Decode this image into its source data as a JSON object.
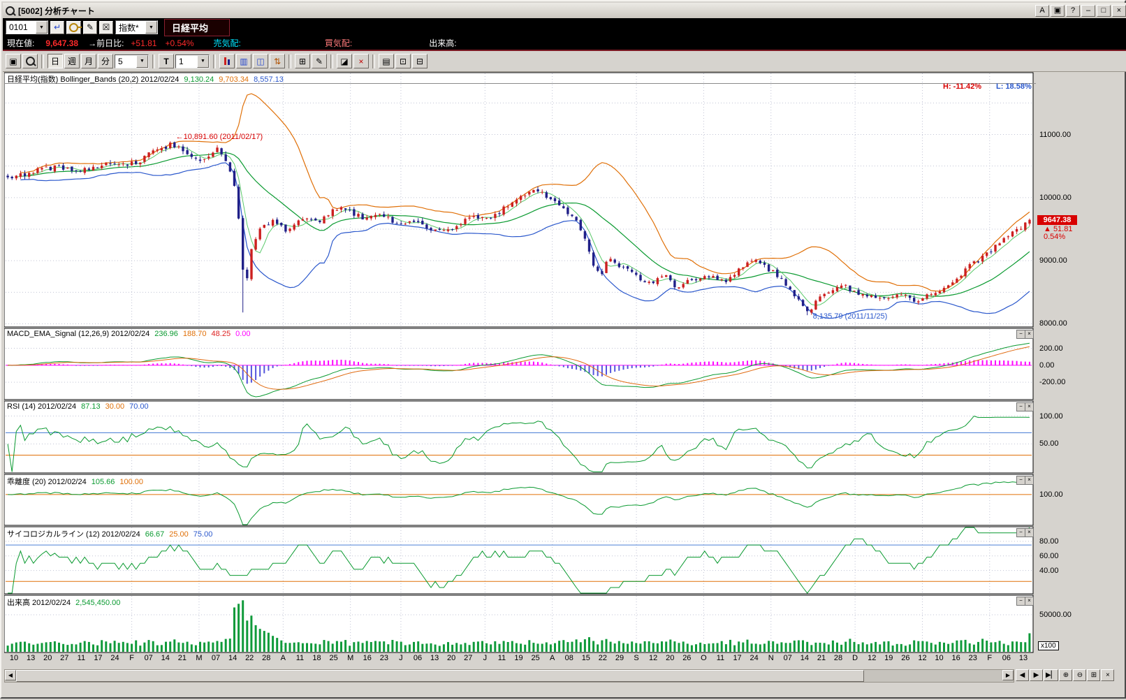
{
  "window": {
    "title": "[5002]  分析チャート",
    "buttons": [
      "A",
      "▣",
      "?",
      "–",
      "□",
      "×"
    ]
  },
  "icons": {
    "dropdown": "▼",
    "minimize": "−",
    "close": "×"
  },
  "toolbar1": {
    "code_value": "0101",
    "index_label": "指数*",
    "instrument": "日経平均",
    "icons": [
      {
        "name": "enter",
        "glyph": "↵",
        "color": "#2244cc"
      },
      {
        "name": "register-key",
        "kind": "key"
      },
      {
        "name": "memo-edit",
        "glyph": "✎"
      },
      {
        "name": "memo-delete",
        "glyph": "☒"
      }
    ]
  },
  "infobar": {
    "segments": [
      {
        "t": "現在値:",
        "c": "#ffffff"
      },
      {
        "t": "9,647.38",
        "c": "#ff2a2a",
        "ml": 16,
        "b": true
      },
      {
        "t": "→前日比:",
        "c": "#ffffff",
        "ml": 14
      },
      {
        "t": "+51.81",
        "c": "#ff2a2a",
        "ml": 10
      },
      {
        "t": "+0.54%",
        "c": "#ff2a2a",
        "ml": 12
      },
      {
        "t": "売気配:",
        "c": "#00e5ff",
        "ml": 28
      },
      {
        "t": "買気配:",
        "c": "#ff7a7a",
        "ml": 120
      },
      {
        "t": "出来高:",
        "c": "#ffffff",
        "ml": 110
      }
    ]
  },
  "toolbar2": {
    "periods": [
      "日",
      "週",
      "月",
      "分"
    ],
    "combo1": "5",
    "t_label": "T",
    "combo2": "1",
    "lead_icons": [
      {
        "name": "new-chart-window",
        "glyph": "▣"
      },
      {
        "name": "chart-search",
        "kind": "mag"
      }
    ],
    "trail_icons": [
      {
        "name": "candlestick-style",
        "kind": "candle"
      },
      {
        "name": "bar-style",
        "glyph": "▥",
        "color": "#2244cc"
      },
      {
        "name": "ohlc-style",
        "glyph": "◫",
        "color": "#2244cc"
      },
      {
        "name": "compare-style",
        "glyph": "⇅",
        "color": "#b05000"
      },
      {
        "sep": true
      },
      {
        "name": "grid-toggle",
        "glyph": "⊞"
      },
      {
        "name": "trendline-tool",
        "glyph": "✎"
      },
      {
        "sep": true
      },
      {
        "name": "eraser-tool",
        "glyph": "◪"
      },
      {
        "name": "delete-drawings",
        "glyph": "×",
        "color": "#c00000"
      },
      {
        "sep": true
      },
      {
        "name": "print-chart",
        "glyph": "▤"
      },
      {
        "name": "copy-chart",
        "glyph": "⊡"
      },
      {
        "name": "save-chart",
        "glyph": "⊟"
      }
    ]
  },
  "panels": {
    "price": {
      "title_segments": [
        {
          "t": "日経平均(指数) Bollinger_Bands (20,2) 2012/02/24",
          "c": "#000000"
        },
        {
          "t": "9,130.24",
          "c": "#0a9a30",
          "ml": 7
        },
        {
          "t": "9,703.34",
          "c": "#e07008",
          "ml": 7
        },
        {
          "t": "8,557.13",
          "c": "#2b58cc",
          "ml": 7
        }
      ],
      "hl_high": "H: -11.42%",
      "hl_low": "L: 18.58%",
      "annotation_high": "←10,891.60 (2011/02/17)",
      "annotation_low": "8,135.79 (2011/11/25)",
      "axis": [
        {
          "v": 11000,
          "label": "11000.00"
        },
        {
          "v": 10000,
          "label": "10000.00"
        },
        {
          "v": 9000,
          "label": "9000.00"
        },
        {
          "v": 8000,
          "label": "8000.00"
        }
      ],
      "tag": {
        "label": "9647.38",
        "change": "▲ 51.81",
        "pct": "0.54%"
      }
    },
    "macd": {
      "title_segments": [
        {
          "t": "MACD_EMA_Signal (12,26,9) 2012/02/24",
          "c": "#000000"
        },
        {
          "t": "236.96",
          "c": "#0a9a30",
          "ml": 7
        },
        {
          "t": "188.70",
          "c": "#e07008",
          "ml": 7
        },
        {
          "t": "48.25",
          "c": "#dd2222",
          "ml": 7
        },
        {
          "t": "0.00",
          "c": "#ff00ff",
          "ml": 7
        }
      ],
      "axis": [
        {
          "v": 200,
          "label": "200.00"
        },
        {
          "v": 0,
          "label": "0.00"
        },
        {
          "v": -200,
          "label": "-200.00"
        }
      ]
    },
    "rsi": {
      "title_segments": [
        {
          "t": "RSI (14) 2012/02/24",
          "c": "#000000"
        },
        {
          "t": "87.13",
          "c": "#0a9a30",
          "ml": 7
        },
        {
          "t": "30.00",
          "c": "#e07008",
          "ml": 7
        },
        {
          "t": "70.00",
          "c": "#2b58cc",
          "ml": 7
        }
      ],
      "axis": [
        {
          "v": 100,
          "label": "100.00"
        },
        {
          "v": 50,
          "label": "50.00"
        }
      ]
    },
    "kairi": {
      "title_segments": [
        {
          "t": "乖離度 (20) 2012/02/24",
          "c": "#000000"
        },
        {
          "t": "105.66",
          "c": "#0a9a30",
          "ml": 7
        },
        {
          "t": "100.00",
          "c": "#e07008",
          "ml": 7
        }
      ],
      "axis": [
        {
          "v": 100,
          "label": "100.00"
        }
      ]
    },
    "psych": {
      "title_segments": [
        {
          "t": "サイコロジカルライン (12) 2012/02/24",
          "c": "#000000"
        },
        {
          "t": "66.67",
          "c": "#0a9a30",
          "ml": 7
        },
        {
          "t": "25.00",
          "c": "#e07008",
          "ml": 7
        },
        {
          "t": "75.00",
          "c": "#2b58cc",
          "ml": 7
        }
      ],
      "axis": [
        {
          "v": 80,
          "label": "80.00"
        },
        {
          "v": 60,
          "label": "60.00"
        },
        {
          "v": 40,
          "label": "40.00"
        }
      ]
    },
    "volume": {
      "title_segments": [
        {
          "t": "出来高 2012/02/24",
          "c": "#000000"
        },
        {
          "t": "2,545,450.00",
          "c": "#0a9a30",
          "ml": 7
        }
      ],
      "axis": [
        {
          "v": 50000,
          "label": "50000.00"
        }
      ],
      "unit": "x100"
    }
  },
  "xaxis_labels": [
    "10",
    "13",
    "20",
    "27",
    "11",
    "17",
    "24",
    "F",
    "07",
    "14",
    "21",
    "M",
    "07",
    "14",
    "22",
    "28",
    "A",
    "11",
    "18",
    "25",
    "M",
    "16",
    "23",
    "J",
    "06",
    "13",
    "20",
    "27",
    "J",
    "11",
    "19",
    "25",
    "A",
    "08",
    "15",
    "22",
    "29",
    "S",
    "12",
    "20",
    "26",
    "O",
    "11",
    "17",
    "24",
    "N",
    "07",
    "14",
    "21",
    "28",
    "D",
    "12",
    "19",
    "26",
    "12",
    "10",
    "16",
    "23",
    "F",
    "06",
    "13"
  ],
  "month_grid_indices": [
    7,
    11,
    16,
    20,
    23,
    28,
    32,
    37,
    41,
    45,
    50,
    54,
    58
  ],
  "bottombar": {
    "scroll_left": "◀",
    "scroll_right": "▶",
    "buttons": [
      {
        "name": "pan-left",
        "glyph": "◀"
      },
      {
        "name": "pan-right",
        "glyph": "▶"
      },
      {
        "name": "pan-latest",
        "glyph": "▶▏"
      },
      {
        "name": "zoom-in",
        "glyph": "⊕"
      },
      {
        "name": "zoom-out",
        "glyph": "⊖"
      },
      {
        "name": "fit-chart",
        "glyph": "⊞"
      },
      {
        "name": "close-panel",
        "glyph": "×"
      }
    ]
  },
  "colors": {
    "up": "#cc2020",
    "down": "#202088",
    "boll_mid": "#0a9a30",
    "boll_up": "#e07008",
    "boll_low": "#2b58cc",
    "ma_fast": "#5ac96a",
    "macd": "#0a9a30",
    "signal": "#e06a10",
    "hist_pos": "#ff00ff",
    "hist_neg": "#5555dd",
    "zero": "#ff00ff",
    "rsi": "#0a9a30",
    "ref_hi": "#4b7fd6",
    "ref_lo": "#e07008",
    "kairi": "#0a9a30",
    "kairi_ref": "#e07008",
    "psych": "#0a9a30",
    "psych_hi": "#4b7fd6",
    "psych_lo": "#e07008",
    "vol": "#0f9a3a",
    "grid": "#c0c3d4",
    "tag_bg": "#d80000"
  },
  "chart_data": {
    "type": "candlestick",
    "title": "日経平均(指数) Bollinger_Bands (20,2)",
    "date": "2012/02/24",
    "last": {
      "close": 9647.38,
      "change": 51.81,
      "change_pct": 0.54
    },
    "bollinger": {
      "period": 20,
      "sigma": 2,
      "mid": 9130.24,
      "upper": 9703.34,
      "lower": 8557.13
    },
    "high_annotation": {
      "value": 10891.6,
      "date": "2011/02/17"
    },
    "low_annotation": {
      "value": 8135.79,
      "date": "2011/11/25"
    },
    "range_pct": {
      "from_high": -11.42,
      "from_low": 18.58
    },
    "ylim": [
      8000,
      11000
    ],
    "n": 240,
    "close_anchors": [
      [
        0,
        10330
      ],
      [
        0.02,
        10390
      ],
      [
        0.045,
        10480
      ],
      [
        0.07,
        10430
      ],
      [
        0.09,
        10520
      ],
      [
        0.11,
        10500
      ],
      [
        0.13,
        10600
      ],
      [
        0.15,
        10780
      ],
      [
        0.16,
        10860
      ],
      [
        0.175,
        10700
      ],
      [
        0.19,
        10620
      ],
      [
        0.205,
        10760
      ],
      [
        0.215,
        10560
      ],
      [
        0.222,
        10220
      ],
      [
        0.227,
        9500
      ],
      [
        0.232,
        8480
      ],
      [
        0.238,
        9180
      ],
      [
        0.245,
        9480
      ],
      [
        0.26,
        9620
      ],
      [
        0.275,
        9470
      ],
      [
        0.29,
        9690
      ],
      [
        0.305,
        9590
      ],
      [
        0.32,
        9840
      ],
      [
        0.335,
        9780
      ],
      [
        0.35,
        9660
      ],
      [
        0.365,
        9760
      ],
      [
        0.38,
        9560
      ],
      [
        0.395,
        9640
      ],
      [
        0.41,
        9520
      ],
      [
        0.425,
        9460
      ],
      [
        0.44,
        9560
      ],
      [
        0.455,
        9690
      ],
      [
        0.47,
        9640
      ],
      [
        0.485,
        9820
      ],
      [
        0.5,
        10030
      ],
      [
        0.515,
        10140
      ],
      [
        0.53,
        10020
      ],
      [
        0.545,
        9840
      ],
      [
        0.557,
        9600
      ],
      [
        0.567,
        9280
      ],
      [
        0.574,
        8920
      ],
      [
        0.58,
        8720
      ],
      [
        0.587,
        9060
      ],
      [
        0.6,
        8900
      ],
      [
        0.615,
        8760
      ],
      [
        0.63,
        8640
      ],
      [
        0.645,
        8760
      ],
      [
        0.655,
        8560
      ],
      [
        0.67,
        8700
      ],
      [
        0.685,
        8760
      ],
      [
        0.7,
        8660
      ],
      [
        0.715,
        8860
      ],
      [
        0.73,
        9010
      ],
      [
        0.745,
        8860
      ],
      [
        0.755,
        8760
      ],
      [
        0.765,
        8540
      ],
      [
        0.775,
        8340
      ],
      [
        0.783,
        8170
      ],
      [
        0.79,
        8340
      ],
      [
        0.8,
        8480
      ],
      [
        0.815,
        8640
      ],
      [
        0.83,
        8500
      ],
      [
        0.845,
        8440
      ],
      [
        0.86,
        8400
      ],
      [
        0.875,
        8460
      ],
      [
        0.89,
        8360
      ],
      [
        0.9,
        8440
      ],
      [
        0.915,
        8560
      ],
      [
        0.93,
        8760
      ],
      [
        0.945,
        8960
      ],
      [
        0.96,
        9120
      ],
      [
        0.975,
        9330
      ],
      [
        0.988,
        9480
      ],
      [
        1,
        9640
      ]
    ],
    "indicators": {
      "macd": {
        "params": [
          12,
          26,
          9
        ],
        "values": [
          236.96,
          188.7,
          48.25,
          0.0
        ],
        "ticks": [
          200,
          0,
          -200
        ]
      },
      "rsi": {
        "params": [
          14
        ],
        "value": 87.13,
        "refs": [
          30,
          70
        ]
      },
      "kairi": {
        "params": [
          20
        ],
        "value": 105.66,
        "ref": 100
      },
      "psych": {
        "params": [
          12
        ],
        "value": 66.67,
        "refs": [
          25,
          75
        ]
      },
      "volume": {
        "value": 2545450.0,
        "tick": 50000,
        "unit": "x100"
      }
    }
  }
}
